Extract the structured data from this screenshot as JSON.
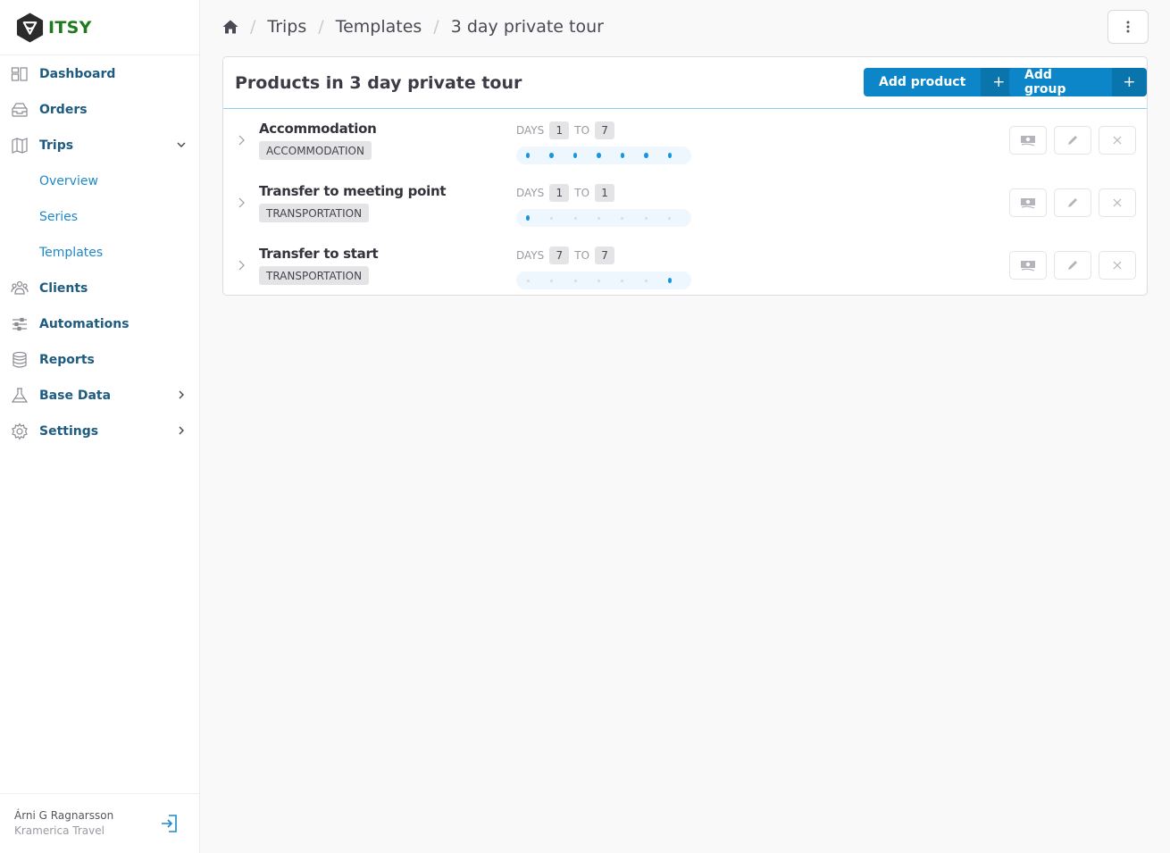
{
  "brand": {
    "name": "ITSY",
    "color": "#1f7a1f"
  },
  "sidebar": {
    "items": [
      {
        "label": "Dashboard",
        "icon": "dashboard-icon"
      },
      {
        "label": "Orders",
        "icon": "inbox-icon"
      },
      {
        "label": "Trips",
        "icon": "map-icon",
        "expanded": true,
        "children": [
          {
            "label": "Overview"
          },
          {
            "label": "Series"
          },
          {
            "label": "Templates"
          }
        ]
      },
      {
        "label": "Clients",
        "icon": "users-icon"
      },
      {
        "label": "Automations",
        "icon": "sliders-icon"
      },
      {
        "label": "Reports",
        "icon": "database-icon"
      },
      {
        "label": "Base Data",
        "icon": "flask-icon",
        "has_children": true
      },
      {
        "label": "Settings",
        "icon": "gear-icon",
        "has_children": true
      }
    ],
    "user": {
      "name": "Árni G Ragnarsson",
      "org": "Kramerica Travel"
    }
  },
  "breadcrumb": {
    "items": [
      "Trips",
      "Templates",
      "3 day private tour"
    ],
    "separator": "/"
  },
  "card": {
    "title": "Products in 3 day private tour",
    "add_product_label": "Add product",
    "add_group_label": "Add group",
    "plus": "+",
    "days_label": "DAYS",
    "to_label": "TO",
    "total_days": 7,
    "products": [
      {
        "name": "Accommodation",
        "tag": "ACCOMMODATION",
        "from": "1",
        "to": "7",
        "active_days": [
          1,
          2,
          3,
          4,
          5,
          6,
          7
        ]
      },
      {
        "name": "Transfer to meeting point",
        "tag": "TRANSPORTATION",
        "from": "1",
        "to": "1",
        "active_days": [
          1
        ]
      },
      {
        "name": "Transfer to start",
        "tag": "TRANSPORTATION",
        "from": "7",
        "to": "7",
        "active_days": [
          7
        ]
      }
    ]
  },
  "colors": {
    "primary": "#0c86c8",
    "primary_dark": "#0a74ad",
    "nav_text": "#1d5b80",
    "sub_nav_text": "#1e88c8",
    "dot_active": "#1496e0"
  }
}
